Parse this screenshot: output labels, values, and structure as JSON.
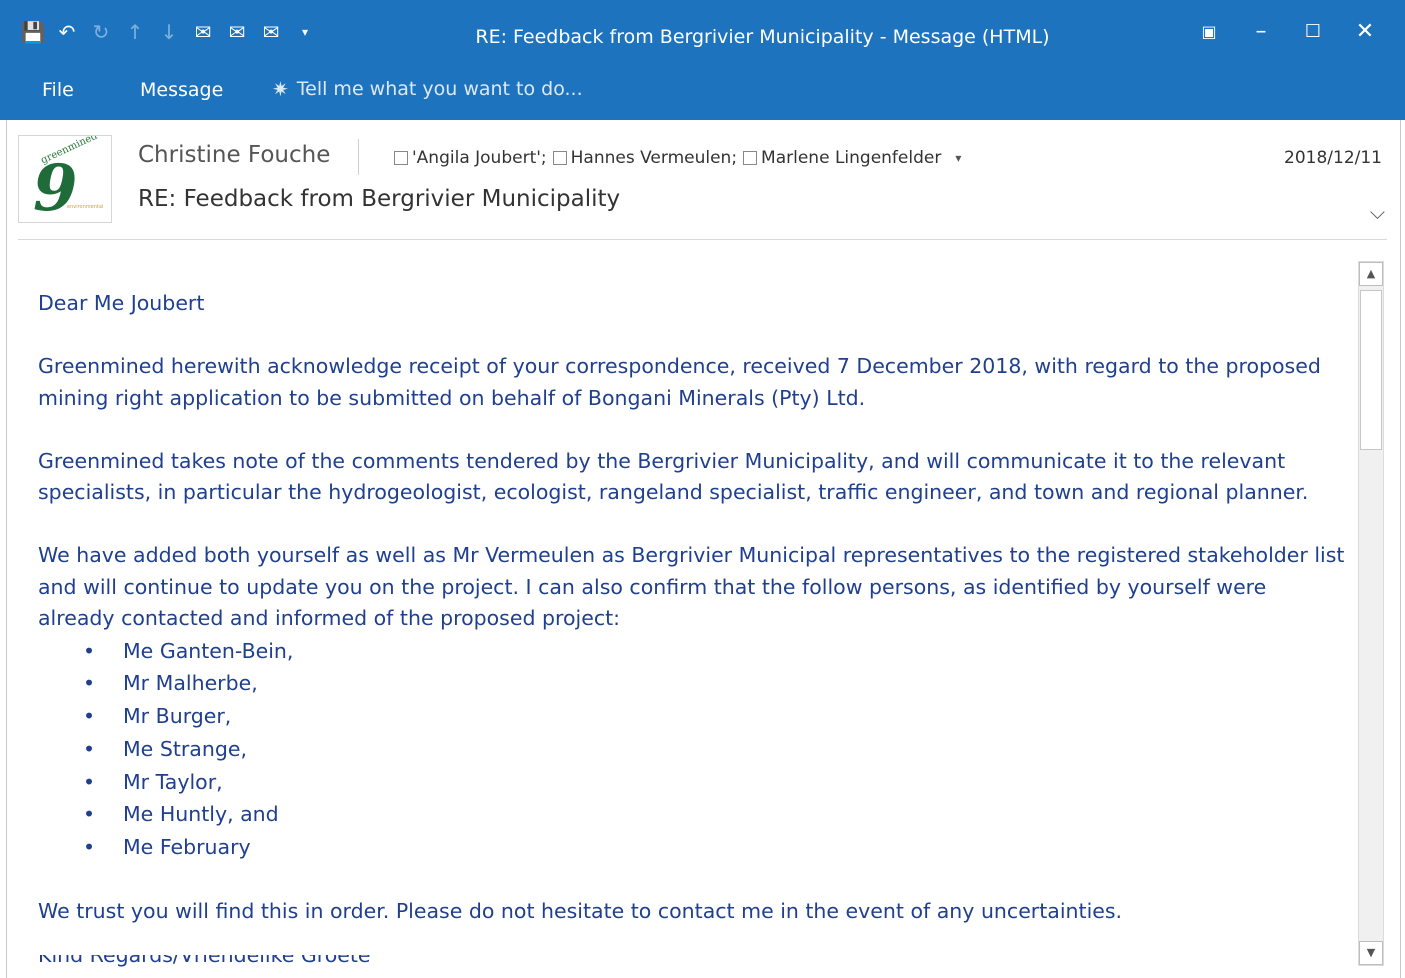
{
  "window": {
    "title": "RE: Feedback from Bergrivier Municipality - Message (HTML)",
    "qat_icons": [
      "save-icon",
      "undo-icon",
      "redo-icon",
      "up-arrow-icon",
      "down-arrow-icon",
      "reply-icon",
      "reply-all-icon",
      "forward-icon",
      "customize-qat-icon"
    ],
    "controls": [
      "ribbon-display-icon",
      "minimize-icon",
      "maximize-icon",
      "close-icon"
    ]
  },
  "ribbon": {
    "tabs": [
      "File",
      "Message"
    ],
    "tell_me_placeholder": "Tell me what you want to do..."
  },
  "header": {
    "sender": "Christine Fouche",
    "recipients": [
      "'Angila Joubert';",
      "Hannes Vermeulen;",
      "Marlene Lingenfelder"
    ],
    "date": "2018/12/11",
    "subject": "RE: Feedback from Bergrivier Municipality"
  },
  "body": {
    "greeting": "Dear Me Joubert",
    "para1": "Greenmined herewith acknowledge receipt of your correspondence, received 7 December 2018, with regard to the proposed mining right application to be submitted on behalf of Bongani Minerals (Pty) Ltd.",
    "para2": "Greenmined takes note of the comments tendered by the Bergrivier Municipality, and will communicate it to the relevant specialists, in particular the hydrogeologist, ecologist, rangeland specialist, traffic engineer, and town and regional planner.",
    "para3": "We have added both yourself as well as Mr Vermeulen as Bergrivier Municipal representatives to the registered stakeholder list and will continue to update you on the project.  I can also confirm that the follow persons, as identified by yourself were already contacted and informed of the proposed project:",
    "persons": [
      "Me Ganten-Bein,",
      "Mr Malherbe,",
      "Mr Burger,",
      "Me Strange,",
      "Mr Taylor,",
      "Me Huntly, and",
      "Me February"
    ],
    "para4": "We trust you will find this in order.  Please do not hesitate to contact me in the event of any uncertainties.",
    "signoff": "Kind Regards/Vriendelike Groete"
  },
  "colors": {
    "accent": "#1e73be",
    "body_text": "#1f3f8f"
  }
}
